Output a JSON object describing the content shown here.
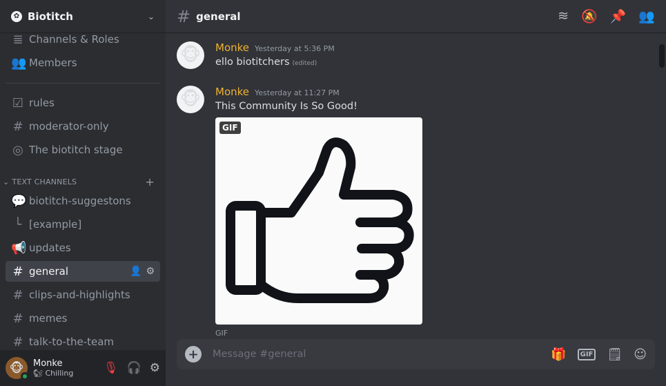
{
  "server": {
    "name": "Biotitch"
  },
  "sidebar": {
    "top_items": [
      {
        "label": "Channels & Roles"
      },
      {
        "label": "Members"
      }
    ],
    "channels": [
      {
        "label": "rules"
      },
      {
        "label": "moderator-only"
      },
      {
        "label": "The biotitch stage"
      }
    ],
    "category": "TEXT CHANNELS",
    "text_channels": [
      {
        "label": "biotitch-suggestons"
      },
      {
        "label": "[example]"
      },
      {
        "label": "updates"
      },
      {
        "label": "general"
      },
      {
        "label": "clips-and-highlights"
      },
      {
        "label": "memes"
      },
      {
        "label": "talk-to-the-team"
      }
    ]
  },
  "user": {
    "name": "Monke",
    "status": "Chilling"
  },
  "topbar": {
    "channel": "general"
  },
  "messages": [
    {
      "author": "Monke",
      "timestamp": "Yesterday at 5:36 PM",
      "text": "ello biotitchers",
      "edited": "(edited)"
    },
    {
      "author": "Monke",
      "timestamp": "Yesterday at 11:27 PM",
      "text": "This Community Is So Good!",
      "gif_badge": "GIF",
      "gif_caption": "GIF"
    }
  ],
  "composer": {
    "placeholder": "Message #general",
    "gif_label": "GIF"
  },
  "colors": {
    "accent_author": "#f0b232",
    "online": "#23a55a",
    "muted": "#f23f43"
  }
}
